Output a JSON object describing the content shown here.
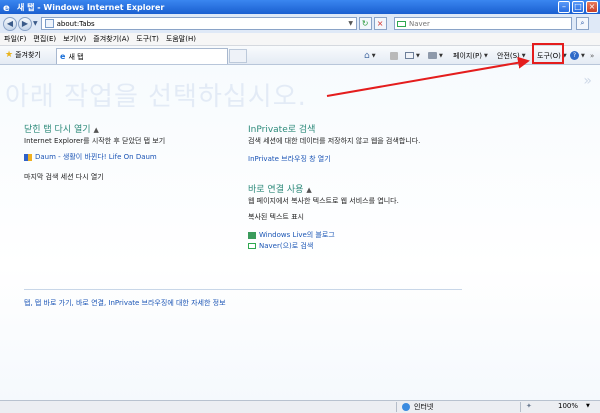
{
  "window": {
    "title": "새 탭 - Windows Internet Explorer"
  },
  "address": {
    "url": "about:Tabs"
  },
  "search": {
    "placeholder": "Naver"
  },
  "menu": [
    "파일(F)",
    "편집(E)",
    "보기(V)",
    "즐겨찾기(A)",
    "도구(T)",
    "도움말(H)"
  ],
  "favorites": {
    "label": "즐겨찾기"
  },
  "tab": {
    "label": "새 탭"
  },
  "commandbar": {
    "page": "페이지(P)",
    "safety": "안전(S)",
    "tools": "도구(O)"
  },
  "content": {
    "hero": "아래 작업을 선택하십시오.",
    "closed_tabs": {
      "title": "닫힌 탭 다시 열기",
      "desc": "Internet Explorer를 시작한 후 닫았던 탭 보기",
      "items": [
        "Daum - 생활이 바뀐다! Life On Daum"
      ],
      "reopen": "마지막 검색 세션 다시 열기"
    },
    "inprivate": {
      "title": "InPrivate로 검색",
      "desc": "검색 세션에 대한 데이터를 저장하지 않고 웹을 검색합니다.",
      "link": "InPrivate 브라우징 창 열기"
    },
    "accelerators": {
      "title": "바로 연결 사용",
      "desc": "웹 페이지에서 복사한 텍스트로 웹 서비스를 엽니다.",
      "show_copied": "복사된 텍스트 표시",
      "links": [
        "Windows Live의 블로그",
        "Naver(으)로 검색"
      ]
    },
    "footer_link": "탭, 탭 바로 가기, 바로 연결, InPrivate 브라우징에 대한 자세한 정보"
  },
  "status": {
    "zone": "인터넷",
    "zoom": "100%"
  },
  "colors": {
    "highlight": "#e41d1d",
    "section_title": "#2d8a7a",
    "link": "#1b55b5"
  }
}
